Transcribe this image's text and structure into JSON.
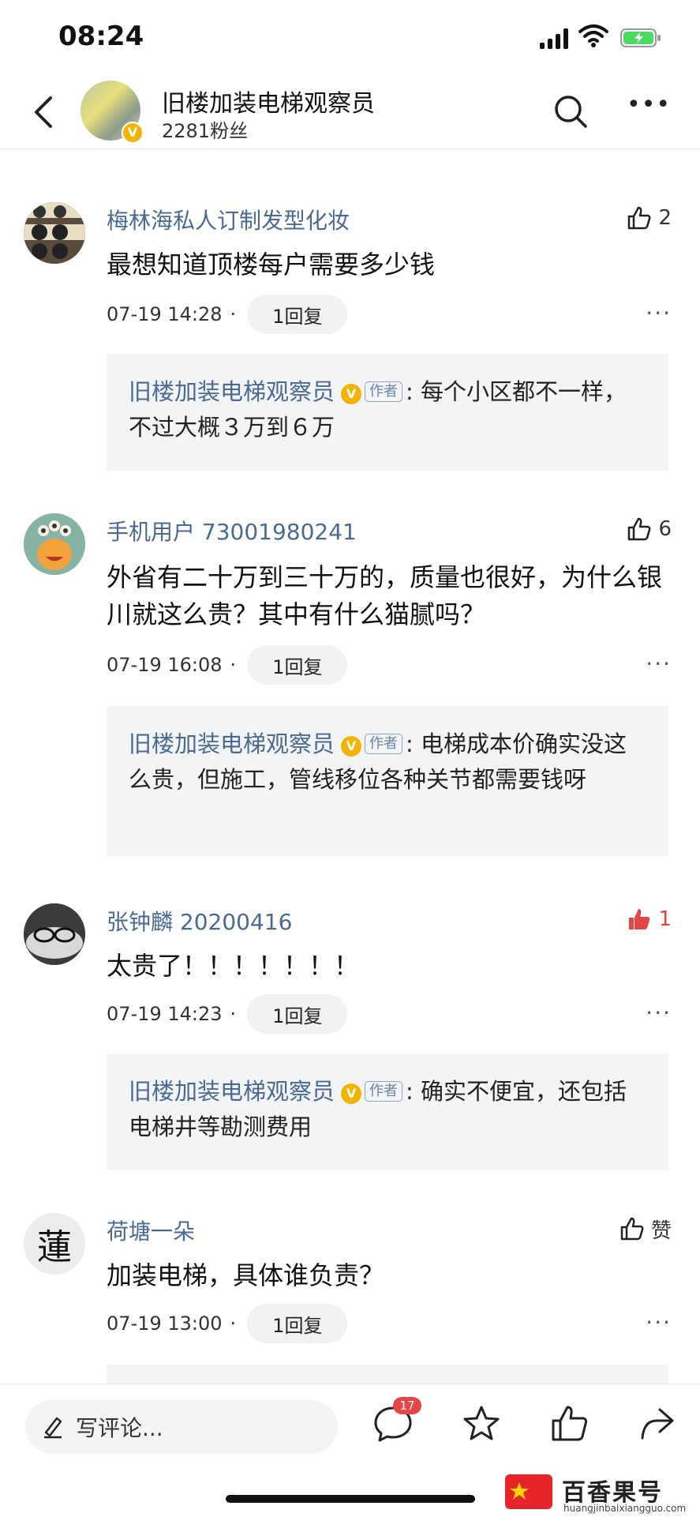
{
  "status_bar": {
    "time": "08:24"
  },
  "header": {
    "title": "旧楼加装电梯观察员",
    "followers": "2281粉丝"
  },
  "comments": [
    {
      "name": "梅林海私人订制发型化妆",
      "likes": "2",
      "liked": false,
      "text": "最想知道顶楼每户需要多少钱",
      "time": "07-19 14:28",
      "dot": "·",
      "reply_count": "1回复",
      "reply": {
        "author": "旧楼加装电梯观察员",
        "tag": "作者",
        "text": "每个小区都不一样，不过大概３万到６万"
      }
    },
    {
      "name": "手机用户 73001980241",
      "likes": "6",
      "liked": false,
      "text": "外省有二十万到三十万的，质量也很好，为什么银川就这么贵？其中有什么猫腻吗？",
      "time": "07-19 16:08",
      "dot": "·",
      "reply_count": "1回复",
      "reply": {
        "author": "旧楼加装电梯观察员",
        "tag": "作者",
        "text": "电梯成本价确实没这么贵，但施工，管线移位各种关节都需要钱呀"
      }
    },
    {
      "name": "张钟麟 20200416",
      "likes": "1",
      "liked": true,
      "text": "太贵了！！！！！！！",
      "time": "07-19 14:23",
      "dot": "·",
      "reply_count": "1回复",
      "reply": {
        "author": "旧楼加装电梯观察员",
        "tag": "作者",
        "text": "确实不便宜，还包括电梯井等勘测费用"
      }
    },
    {
      "name": "荷塘一朵",
      "likes": "赞",
      "liked": false,
      "text": "加装电梯，具体谁负责？",
      "time": "07-19 13:00",
      "dot": "·",
      "reply_count": "1回复",
      "avatar_char": "蓮"
    }
  ],
  "bottom_bar": {
    "write_placeholder": "写评论...",
    "comment_count": "17"
  },
  "watermark": {
    "title": "百香果号",
    "url": "huangjinbaixiangguo.com"
  },
  "colors": {
    "name_link": "#4a6a93",
    "liked": "#e64545",
    "vip_badge": "#f2b400",
    "reply_bg": "#f3f4f6"
  }
}
